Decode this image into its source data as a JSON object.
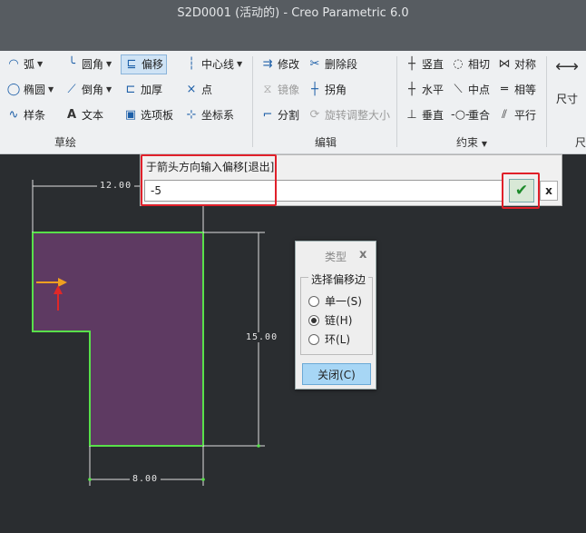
{
  "window": {
    "title": "S2D0001 (活动的) - Creo Parametric 6.0"
  },
  "ribbon": {
    "sketch": {
      "label": "草绘",
      "arc": "弧",
      "fillet": "圆角",
      "offset": "偏移",
      "centerline": "中心线",
      "ellipse": "椭圆",
      "chamfer": "倒角",
      "thicken": "加厚",
      "point": "点",
      "spline": "样条",
      "text": "文本",
      "palette": "选项板",
      "coordsys": "坐标系"
    },
    "edit": {
      "label": "编辑",
      "modify": "修改",
      "delete_segment": "删除段",
      "mirror": "镜像",
      "corner": "拐角",
      "divide": "分割",
      "rotate_resize": "旋转调整大小"
    },
    "constrain": {
      "label": "约束",
      "vertical": "竖直",
      "tangent": "相切",
      "symmetric": "对称",
      "horizontal": "水平",
      "midpoint": "中点",
      "equal": "相等",
      "perpendicular": "垂直",
      "coincident": "重合",
      "parallel": "平行"
    },
    "dimension": {
      "label": "尺寸",
      "label_cut": "尺"
    }
  },
  "input_prompt": {
    "prompt": "于箭头方向输入偏移[退出]",
    "value": "-5",
    "ok_icon": "checkmark-icon",
    "cancel_label": "x"
  },
  "type_dialog": {
    "title": "类型",
    "close_glyph": "x",
    "group_label": "选择偏移边",
    "options": [
      {
        "label": "单一(S)",
        "selected": false
      },
      {
        "label": "链(H)",
        "selected": true
      },
      {
        "label": "环(L)",
        "selected": false
      }
    ],
    "close_button": "关闭(C)"
  },
  "sketch": {
    "dimensions": {
      "top_width": "12.00",
      "right_height": "15.00",
      "bottom_width": "8.00"
    },
    "colors": {
      "fill": "#5e3a62",
      "outline": "#58e04a",
      "arrow": "#f0a020",
      "marker": "#e02828",
      "dimension": "#e0e0e0"
    }
  }
}
